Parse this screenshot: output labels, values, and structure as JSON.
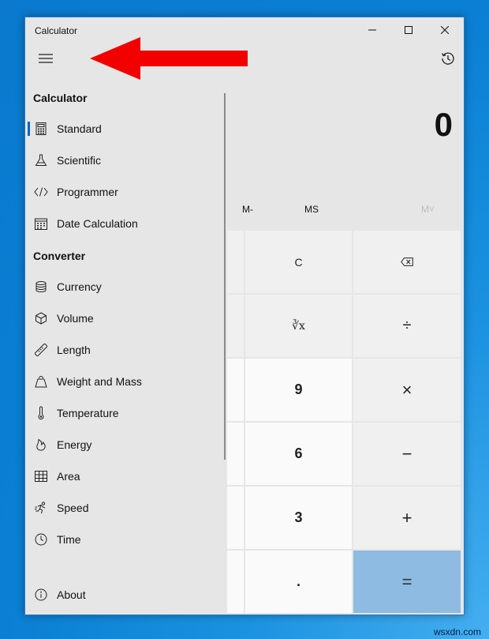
{
  "window": {
    "title": "Calculator"
  },
  "display": {
    "value": "0"
  },
  "memory": {
    "m_minus": "M-",
    "ms": "MS",
    "m_up": "M˅"
  },
  "keys": {
    "c": "C",
    "root": "∛x",
    "divide": "÷",
    "nine": "9",
    "times": "×",
    "six": "6",
    "minus": "−",
    "three": "3",
    "plus": "+",
    "dot": ".",
    "equals": "="
  },
  "nav": {
    "calc_header": "Calculator",
    "calc_items": [
      {
        "label": "Standard",
        "icon": "calculator-icon"
      },
      {
        "label": "Scientific",
        "icon": "flask-icon"
      },
      {
        "label": "Programmer",
        "icon": "code-icon"
      },
      {
        "label": "Date Calculation",
        "icon": "calendar-icon"
      }
    ],
    "conv_header": "Converter",
    "conv_items": [
      {
        "label": "Currency",
        "icon": "coins-icon"
      },
      {
        "label": "Volume",
        "icon": "cube-icon"
      },
      {
        "label": "Length",
        "icon": "ruler-icon"
      },
      {
        "label": "Weight and Mass",
        "icon": "weight-icon"
      },
      {
        "label": "Temperature",
        "icon": "thermometer-icon"
      },
      {
        "label": "Energy",
        "icon": "flame-icon"
      },
      {
        "label": "Area",
        "icon": "grid-icon"
      },
      {
        "label": "Speed",
        "icon": "runner-icon"
      },
      {
        "label": "Time",
        "icon": "clock-icon"
      }
    ],
    "about": "About",
    "selected": "Standard"
  },
  "colors": {
    "accent": "#0a64c4",
    "equals_key": "#8dbbe2",
    "annotation_arrow": "#f20000"
  },
  "watermark": "wsxdn.com"
}
